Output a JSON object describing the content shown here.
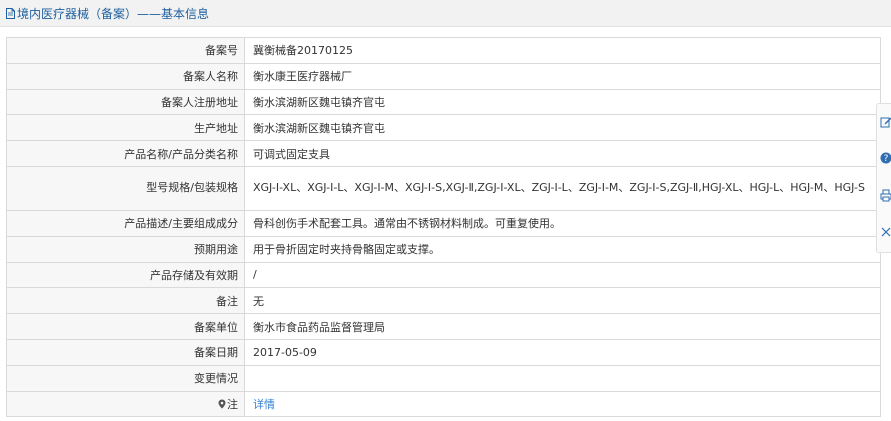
{
  "header": {
    "title": "境内医疗器械（备案）——基本信息"
  },
  "rows": [
    {
      "label": "备案号",
      "value": "冀衡械备20170125"
    },
    {
      "label": "备案人名称",
      "value": "衡水康王医疗器械厂"
    },
    {
      "label": "备案人注册地址",
      "value": "衡水滨湖新区魏屯镇齐官屯"
    },
    {
      "label": "生产地址",
      "value": "衡水滨湖新区魏屯镇齐官屯"
    },
    {
      "label": "产品名称/产品分类名称",
      "value": "可调式固定支具"
    },
    {
      "label": "型号规格/包装规格",
      "value": "XGJ-Ⅰ-XL、XGJ-Ⅰ-L、XGJ-Ⅰ-M、XGJ-Ⅰ-S,XGJ-Ⅱ,ZGJ-Ⅰ-XL、ZGJ-Ⅰ-L、ZGJ-Ⅰ-M、ZGJ-Ⅰ-S,ZGJ-Ⅱ,HGJ-XL、HGJ-L、HGJ-M、HGJ-S"
    },
    {
      "label": "产品描述/主要组成成分",
      "value": "骨科创伤手术配套工具。通常由不锈钢材料制成。可重复使用。"
    },
    {
      "label": "预期用途",
      "value": "用于骨折固定时夹持骨骼固定或支撑。"
    },
    {
      "label": "产品存储及有效期",
      "value": "/"
    },
    {
      "label": "备注",
      "value": "无"
    },
    {
      "label": "备案单位",
      "value": "衡水市食品药品监督管理局"
    },
    {
      "label": "备案日期",
      "value": "2017-05-09"
    },
    {
      "label": "变更情况",
      "value": ""
    },
    {
      "label": "注",
      "value": "详情"
    }
  ],
  "colors": {
    "header_text": "#1f5f9f",
    "link": "#2f7fd4",
    "label_bg": "#f7f7f7",
    "border": "#d9d9d9"
  },
  "side_toolbar": {
    "icons": [
      "edit-icon",
      "help-icon",
      "print-icon",
      "close-icon"
    ]
  }
}
